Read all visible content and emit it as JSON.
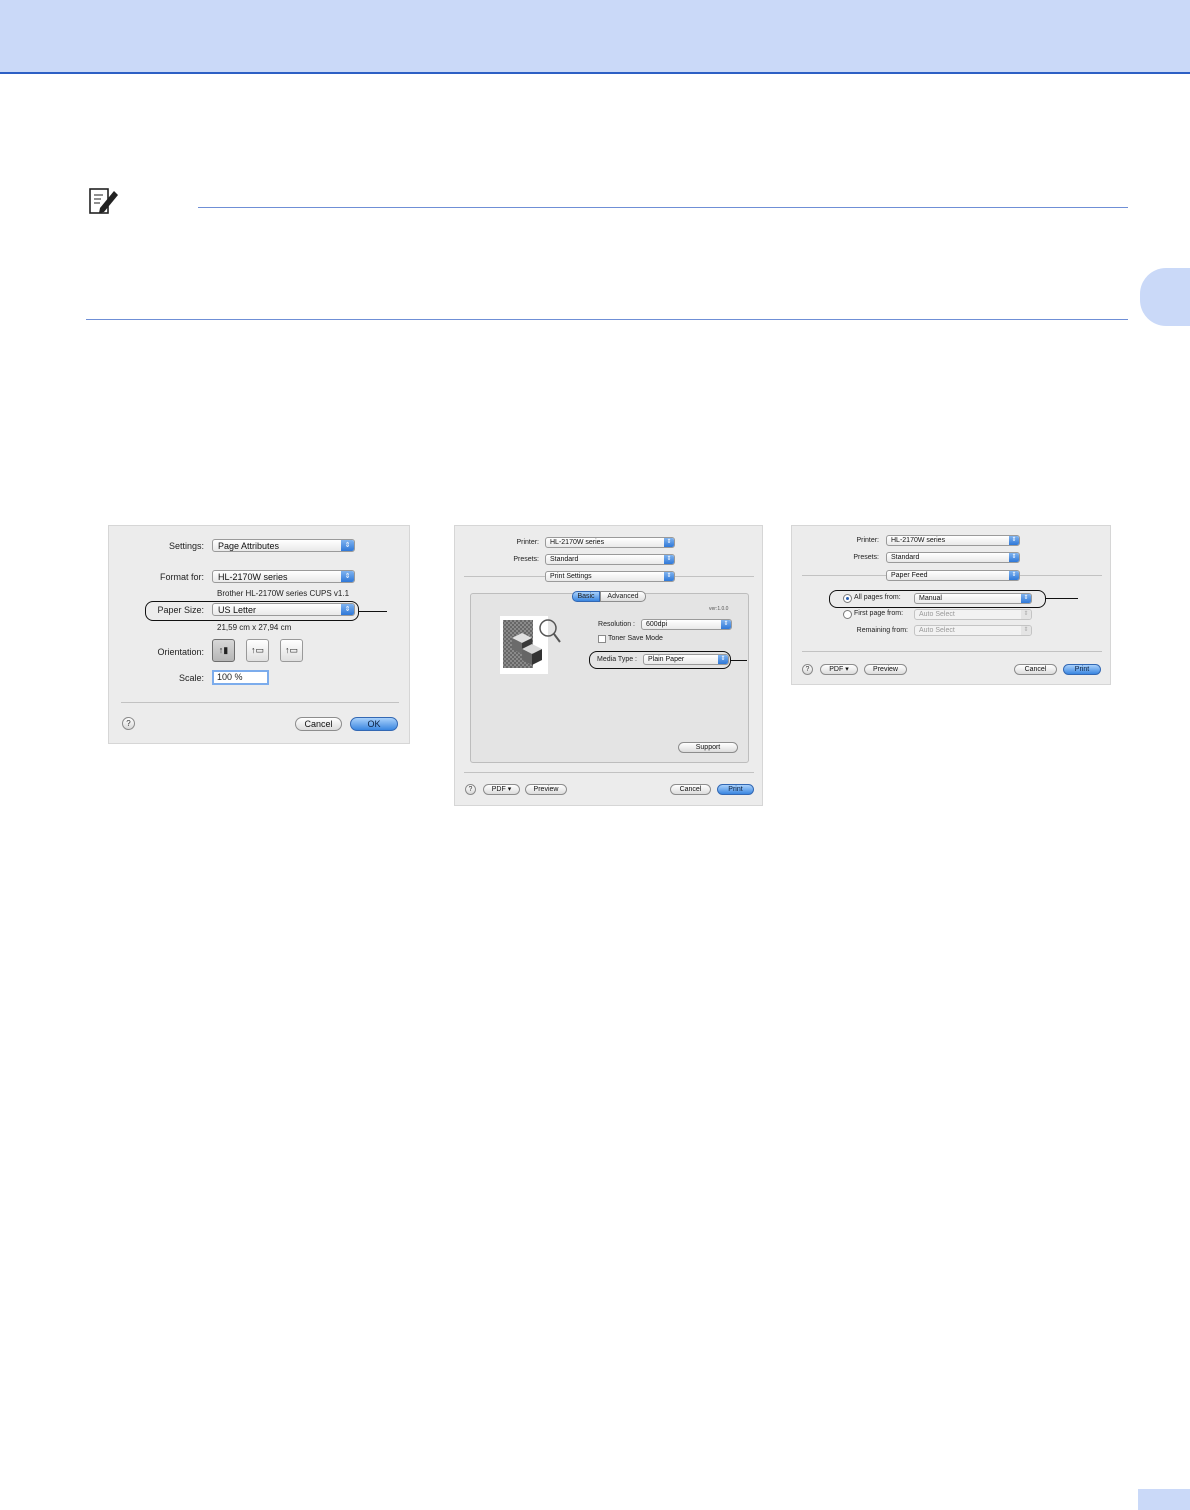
{
  "dialog1": {
    "settings_label": "Settings:",
    "settings_value": "Page Attributes",
    "format_label": "Format for:",
    "format_value": "HL-2170W series",
    "format_desc": "Brother HL-2170W series CUPS v1.1",
    "paper_label": "Paper Size:",
    "paper_value": "US Letter",
    "paper_dims": "21,59 cm x 27,94 cm",
    "orientation_label": "Orientation:",
    "scale_label": "Scale:",
    "scale_value": "100 %",
    "help": "?",
    "cancel": "Cancel",
    "ok": "OK"
  },
  "dialog2": {
    "printer_label": "Printer:",
    "printer_value": "HL-2170W series",
    "presets_label": "Presets:",
    "presets_value": "Standard",
    "panel_value": "Print Settings",
    "tab_basic": "Basic",
    "tab_advanced": "Advanced",
    "version": "ver:1.0.0",
    "resolution_label": "Resolution :",
    "resolution_value": "600dpi",
    "toner_label": "Toner Save Mode",
    "media_label": "Media Type :",
    "media_value": "Plain Paper",
    "support": "Support",
    "help": "?",
    "pdf": "PDF ▾",
    "preview": "Preview",
    "cancel": "Cancel",
    "print": "Print"
  },
  "dialog3": {
    "printer_label": "Printer:",
    "printer_value": "HL-2170W series",
    "presets_label": "Presets:",
    "presets_value": "Standard",
    "panel_value": "Paper Feed",
    "all_pages_label": "All pages from:",
    "all_pages_value": "Manual",
    "first_page_label": "First page from:",
    "first_page_value": "Auto Select",
    "remaining_label": "Remaining from:",
    "remaining_value": "Auto Select",
    "help": "?",
    "pdf": "PDF ▾",
    "preview": "Preview",
    "cancel": "Cancel",
    "print": "Print"
  }
}
